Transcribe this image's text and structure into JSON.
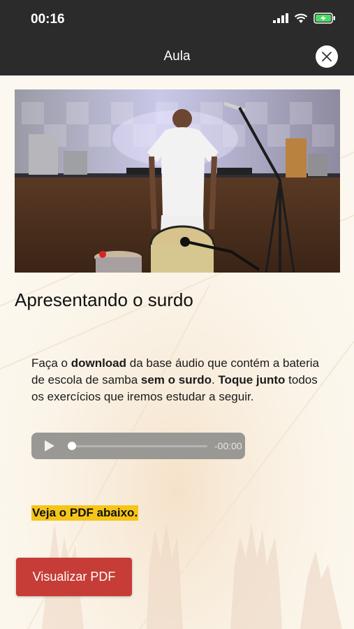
{
  "status_bar": {
    "time": "00:16"
  },
  "nav": {
    "title": "Aula"
  },
  "lesson": {
    "title": "Apresentando o surdo"
  },
  "description": {
    "t1": "Faça o ",
    "b1": "download",
    "t2": " da base áudio que contém a bateria de escola de samba ",
    "b2": "sem o surdo",
    "t3": ". ",
    "b3": "Toque junto",
    "t4": " todos os exercícios que iremos estudar a seguir."
  },
  "audio": {
    "time": "-00:00",
    "progress": 0
  },
  "pdf_note": "Veja o PDF abaixo.",
  "pdf_button": "Visualizar PDF",
  "colors": {
    "bar": "#2b2b2b",
    "button": "#c63c36",
    "highlight": "#f5c518"
  }
}
